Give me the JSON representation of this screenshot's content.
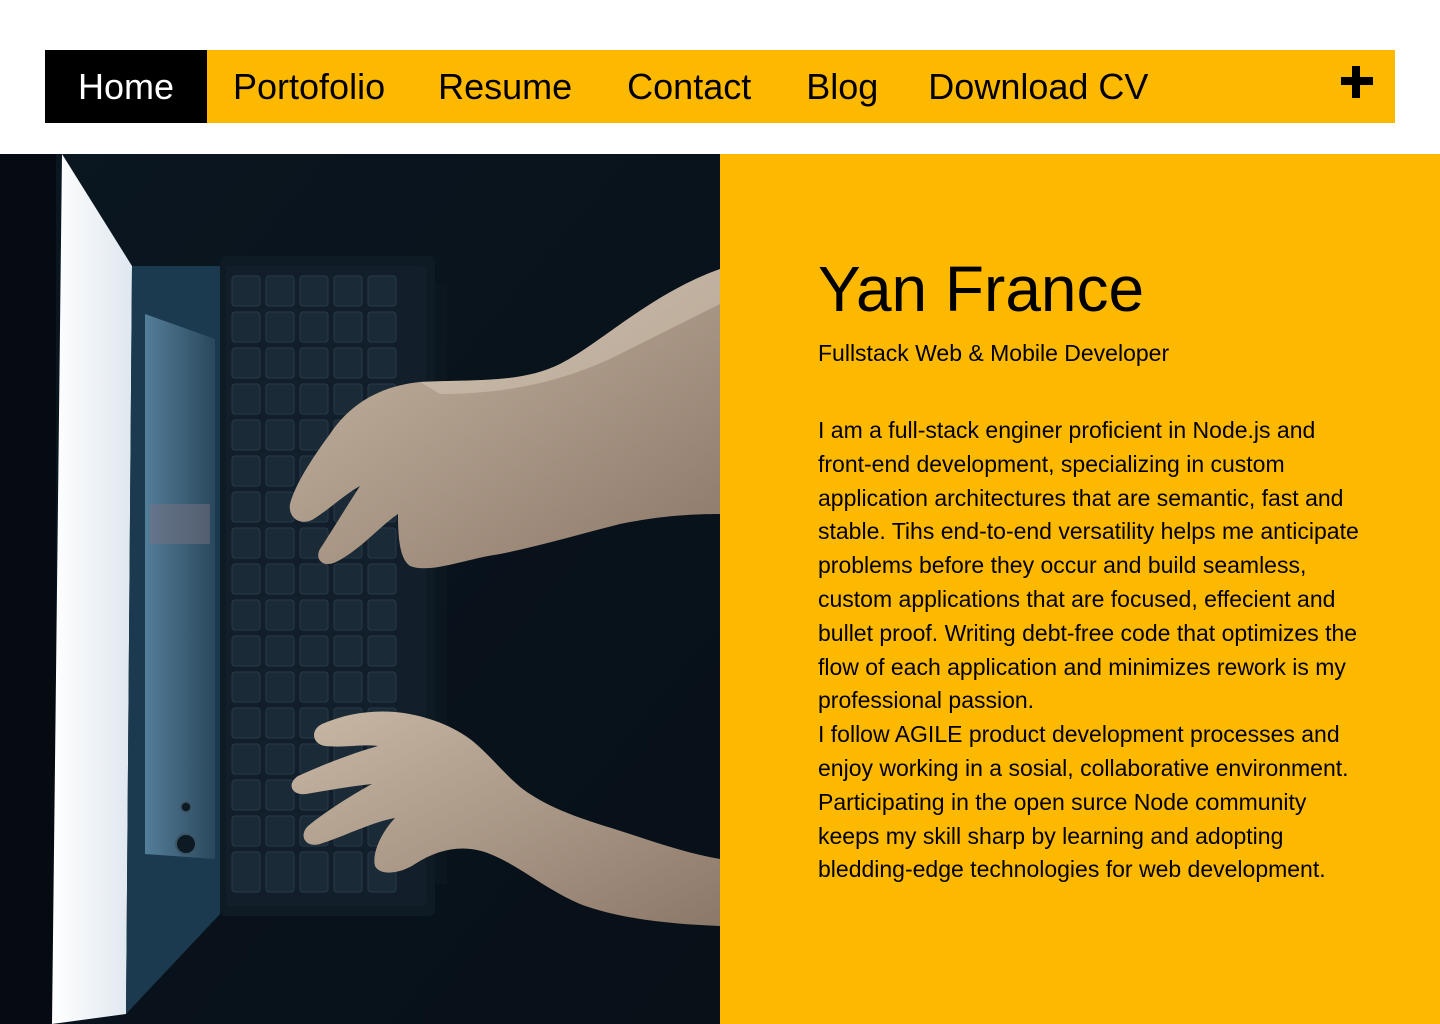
{
  "nav": {
    "items": [
      {
        "label": "Home",
        "active": true
      },
      {
        "label": "Portofolio",
        "active": false
      },
      {
        "label": "Resume",
        "active": false
      },
      {
        "label": "Contact",
        "active": false
      },
      {
        "label": "Blog",
        "active": false
      },
      {
        "label": "Download CV",
        "active": false
      }
    ],
    "expand_icon": "plus-icon"
  },
  "hero": {
    "image_icon": "laptop-typing-photo",
    "name": "Yan France",
    "subtitle": "Fullstack Web & Mobile Developer",
    "bio_paragraphs": [
      "I am a full-stack enginer proficient in Node.js and front-end development, specializing in custom application architectures that are semantic, fast and stable. Tihs end-to-end versatility helps me anticipate problems before they occur and build seamless, custom applications that are focused, effecient and bullet proof. Writing debt-free code that optimizes the flow of each application and minimizes rework is my professional passion.",
      "I follow AGILE product development processes and enjoy working in a sosial, collaborative environment. Participating in the open surce Node community keeps my skill sharp by learning and adopting bledding-edge technologies for web development."
    ]
  },
  "colors": {
    "accent": "#FDB800",
    "nav_active_bg": "#000000",
    "nav_active_text": "#FFFFFF",
    "text": "#000000"
  }
}
